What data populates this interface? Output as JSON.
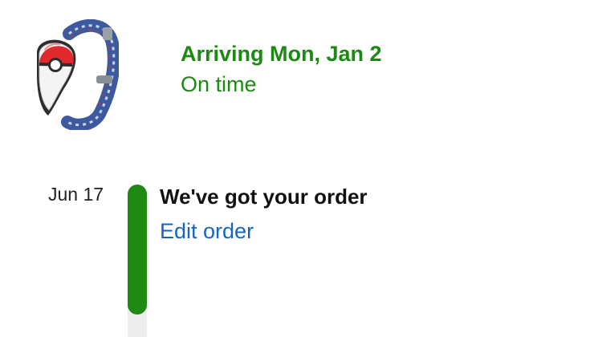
{
  "product": {
    "icon": "poke-ball-wristband-icon"
  },
  "delivery": {
    "arrival_label": "Arriving Mon, Jan 2",
    "status": "On time",
    "status_color": "#1a8a10"
  },
  "timeline": {
    "progress_color": "#1e8a12",
    "events": [
      {
        "date": "Jun 17",
        "title": "We've got your order",
        "action_label": "Edit order",
        "action_color": "#1565c0"
      }
    ]
  }
}
